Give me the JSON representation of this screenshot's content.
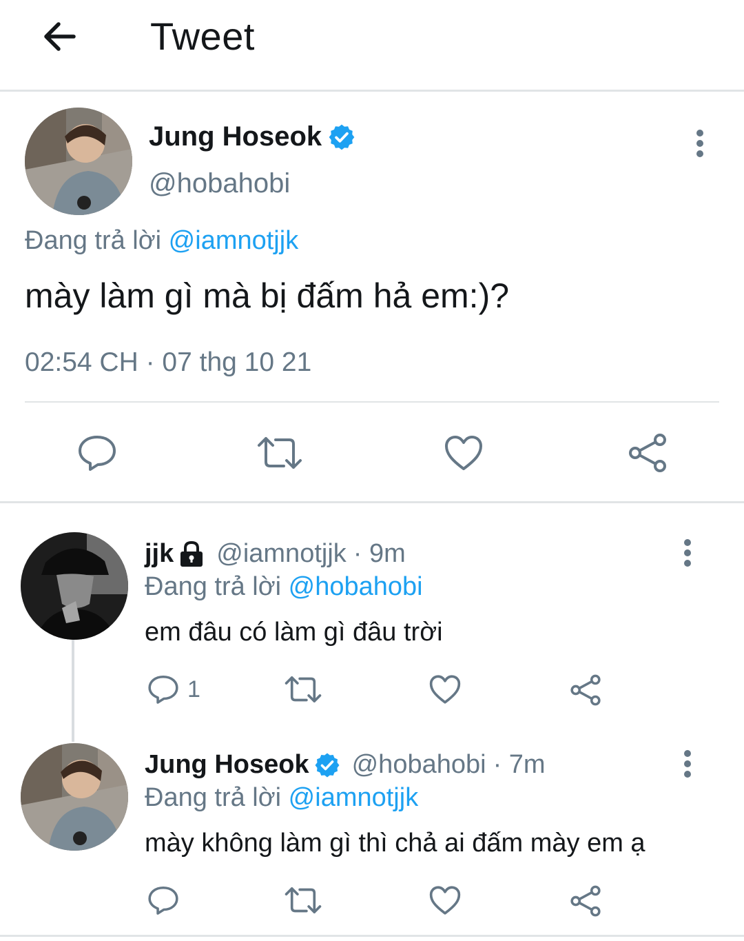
{
  "header": {
    "title": "Tweet",
    "back_icon": "arrow-left-icon"
  },
  "main_tweet": {
    "name": "Jung Hoseok",
    "handle": "@hobahobi",
    "verified": true,
    "replying_prefix": "Đang trả lời",
    "replying_to": "@iamnotjjk",
    "text": "mày làm gì mà bị đấm hả em:)?",
    "timestamp": "02:54 CH · 07 thg 10 21",
    "actions": [
      "reply-icon",
      "retweet-icon",
      "like-icon",
      "share-icon"
    ]
  },
  "replies": [
    {
      "name": "jjk",
      "protected": true,
      "handle": "@iamnotjjk",
      "time": "· 9m",
      "replying_prefix": "Đang trả lời",
      "replying_to": "@hobahobi",
      "text": "em đâu có làm gì đâu trời",
      "reply_count": "1"
    },
    {
      "name": "Jung Hoseok",
      "verified": true,
      "handle": "@hobahobi",
      "time": "· 7m",
      "replying_prefix": "Đang trả lời",
      "replying_to": "@iamnotjjk",
      "text": "mày không làm gì thì chả ai đấm mày em ạ"
    }
  ],
  "colors": {
    "accent": "#1da1f2",
    "secondary_text": "#657786",
    "divider": "#e1e4e6"
  }
}
